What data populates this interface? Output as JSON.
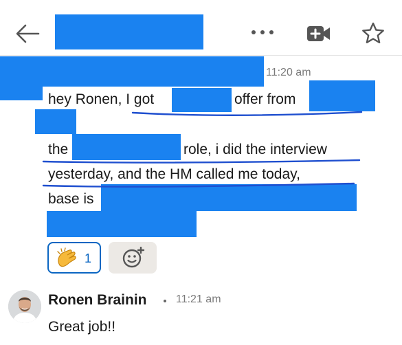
{
  "header": {
    "back_icon": "back-arrow-icon",
    "more_icon": "more-horizontal-icon",
    "video_icon": "video-call-icon",
    "star_icon": "star-icon"
  },
  "message_1": {
    "timestamp": "11:20 am",
    "line1_a": "hey Ronen, I got",
    "line1_b": "offer from",
    "line2_a": "the",
    "line2_b": "role, i did the interview",
    "line3": "yesterday, and the HM called me today,",
    "line4": "base is",
    "reaction": {
      "icon": "clapping-hands-icon",
      "count": "1"
    },
    "add_reaction_icon": "add-emoji-icon"
  },
  "message_2": {
    "sender": "Ronen Brainin",
    "timestamp": "11:21 am",
    "text": "Great job!!"
  },
  "colors": {
    "redaction": "#1a82f0",
    "underline": "#1f4fcf",
    "reaction_border": "#0a66c2",
    "add_reaction_bg": "#ece9e5"
  }
}
